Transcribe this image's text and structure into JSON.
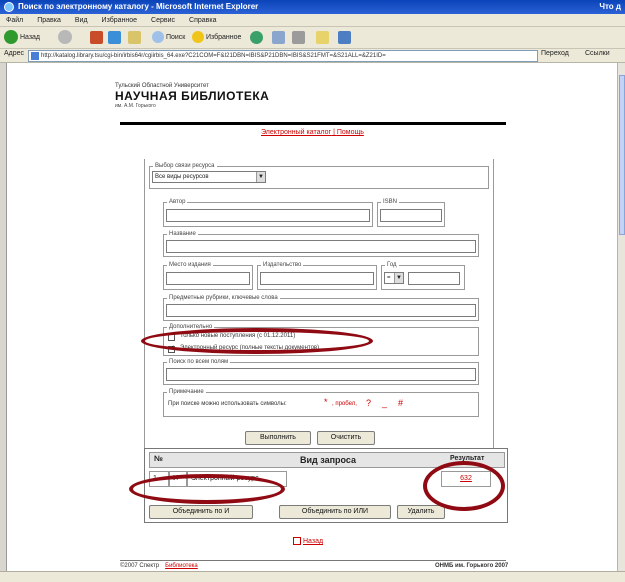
{
  "window": {
    "title": "Поиск по электронному каталогу - Microsoft Internet Explorer",
    "right_tag": "Что д"
  },
  "menu": [
    "Файл",
    "Правка",
    "Вид",
    "Избранное",
    "Сервис",
    "Справка"
  ],
  "toolbar": {
    "back": "Назад",
    "search": "Поиск",
    "favorites": "Избранное"
  },
  "address": {
    "label": "Адрес",
    "url": "http://katalog.library.tsu/cgi-bin/irbis64r/cgiirbis_64.exe?C21COM=F&I21DBN=IBIS&P21DBN=IBIS&S21FMT=&S21ALL=&Z21ID=",
    "go": "Переход",
    "links": "Ссылки"
  },
  "library": {
    "line1": "Тульский Областной Университет",
    "line2": "НАУЧНАЯ БИБЛИОТЕКА",
    "line3": "им. А.М. Горького"
  },
  "toplinks": {
    "catalog": "Электронный каталог",
    "sep": " | ",
    "help": "Помощь"
  },
  "form": {
    "resource_legend": "Выбор связи ресурса",
    "resource_value": "Все виды ресурсов",
    "author_legend": "Автор",
    "isbn_legend": "ISBN",
    "title_legend": "Название",
    "place_legend": "Место издания",
    "publisher_legend": "Издательство",
    "year_legend": "Год",
    "year_op": "=",
    "subjects_legend": "Предметные рубрики, ключевые слова",
    "extra_legend": "Дополнительно",
    "extra_opt1": "Только новые поступления (с 01.12.2011)",
    "extra_opt2": "Электронный ресурс (полные тексты документов)",
    "fulltext_legend": "Поиск по всем полям",
    "note_legend": "Примечание",
    "note_text": "При поиске можно использовать символы:",
    "symbols": [
      "*",
      ", пробел,",
      "?",
      "_",
      "#"
    ],
    "execute_btn": "Выполнить",
    "clear_btn": "Очистить"
  },
  "requests": {
    "col_num": "№",
    "col_type": "Вид запроса",
    "col_result": "Результат",
    "rows": [
      {
        "num": "1",
        "op": "И",
        "type": "Электронный ресурс",
        "count": "632"
      }
    ],
    "btn_and": "Объединить по И",
    "btn_or": "Объединить по ИЛИ",
    "btn_delete": "Удалить"
  },
  "pager": {
    "label": "Назад"
  },
  "footer": {
    "left": "©2007 Спектр",
    "left_link": "Библиотека",
    "right": "ОНМБ им. Горького 2007"
  },
  "colors": {
    "accent_red": "#8f0a12",
    "link_red": "#cc0000",
    "window_blue": "#0b43b8"
  },
  "icons": [
    "ie-logo-icon",
    "back-arrow-icon",
    "forward-arrow-icon",
    "stop-icon",
    "refresh-icon",
    "home-icon",
    "search-icon",
    "favorites-star-icon",
    "history-icon",
    "mail-icon",
    "print-icon",
    "page-icon"
  ]
}
